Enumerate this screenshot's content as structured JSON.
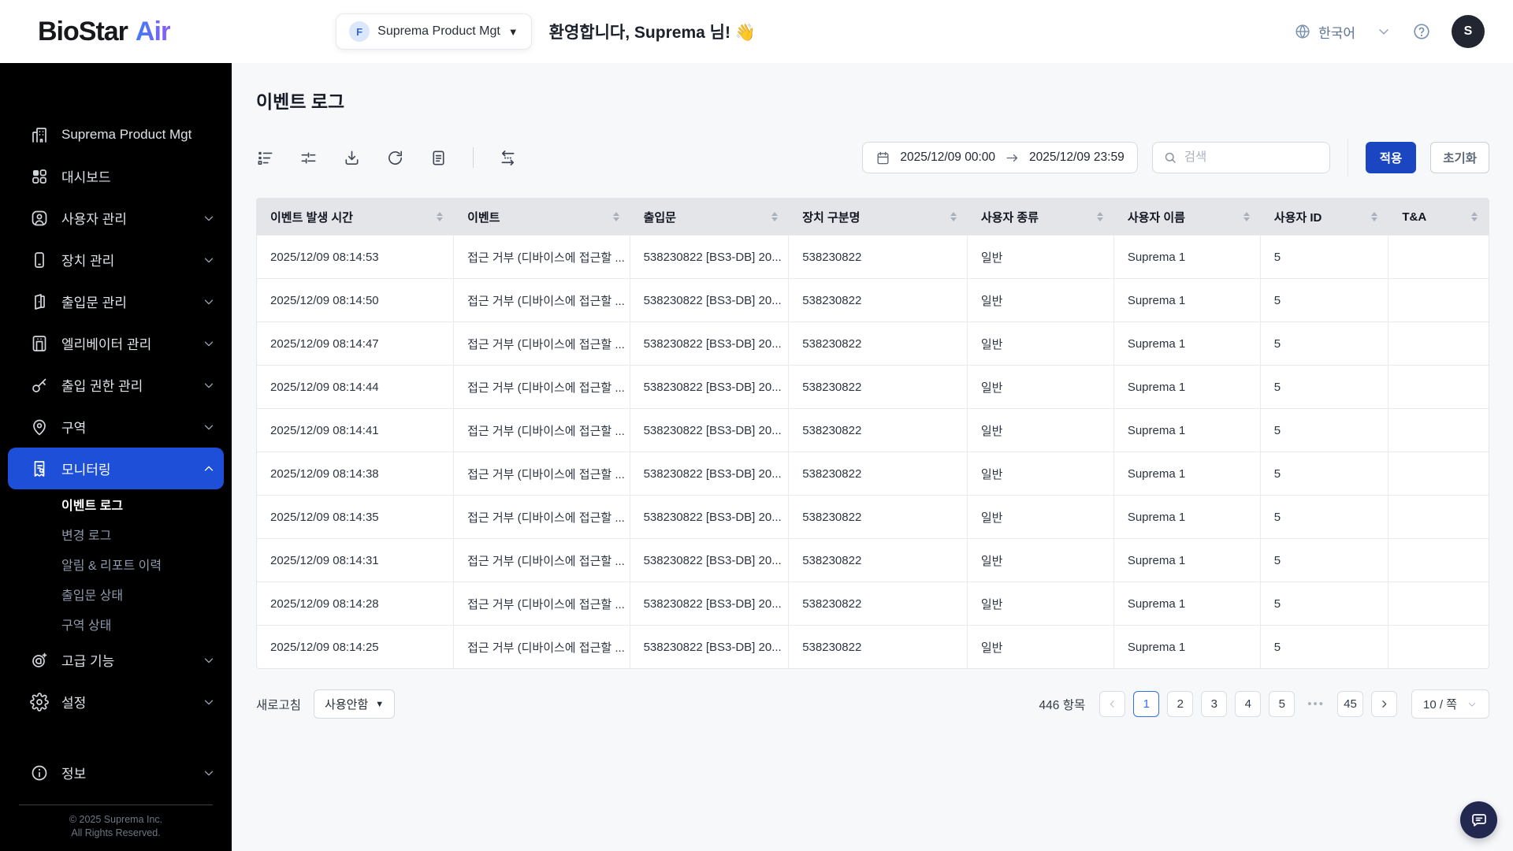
{
  "header": {
    "logo": {
      "part1": "BioStar",
      "part2": "Air"
    },
    "org_selector": {
      "badge": "F",
      "label": "Suprema Product Mgt"
    },
    "welcome": "환영합니다, Suprema 님! 👋",
    "language": "한국어",
    "avatar_initial": "S"
  },
  "sidebar": {
    "items": [
      {
        "label": "Suprema Product Mgt",
        "icon": "building",
        "expandable": false
      },
      {
        "label": "대시보드",
        "icon": "dashboard",
        "expandable": false
      },
      {
        "label": "사용자 관리",
        "icon": "users",
        "expandable": true
      },
      {
        "label": "장치 관리",
        "icon": "device",
        "expandable": true
      },
      {
        "label": "출입문 관리",
        "icon": "door",
        "expandable": true
      },
      {
        "label": "엘리베이터 관리",
        "icon": "elevator",
        "expandable": true
      },
      {
        "label": "출입 권한 관리",
        "icon": "key",
        "expandable": true
      },
      {
        "label": "구역",
        "icon": "zone",
        "expandable": true
      },
      {
        "label": "모니터링",
        "icon": "monitoring",
        "expandable": true,
        "active": true,
        "expanded": true,
        "children": [
          "이벤트 로그",
          "변경 로그",
          "알림 & 리포트 이력",
          "출입문 상태",
          "구역 상태"
        ],
        "active_child": "이벤트 로그"
      },
      {
        "label": "고급 기능",
        "icon": "advanced",
        "expandable": true
      },
      {
        "label": "설정",
        "icon": "settings",
        "expandable": true
      }
    ],
    "info_item": {
      "label": "정보",
      "icon": "info",
      "expandable": true
    },
    "copyright_line1": "© 2025 Suprema Inc.",
    "copyright_line2": "All Rights Reserved."
  },
  "page": {
    "title": "이벤트 로그"
  },
  "toolbar": {
    "date_from": "2025/12/09 00:00",
    "date_to": "2025/12/09 23:59",
    "search_placeholder": "검색",
    "apply_label": "적용",
    "reset_label": "초기화"
  },
  "table": {
    "columns": [
      "이벤트 발생 시간",
      "이벤트",
      "출입문",
      "장치 구분명",
      "사용자 종류",
      "사용자 이름",
      "사용자 ID",
      "T&A"
    ],
    "rows": [
      {
        "time": "2025/12/09 08:14:53",
        "event": "접근 거부 (디바이스에 접근할 ...",
        "door": "538230822 [BS3-DB] 20...",
        "device": "538230822",
        "user_type": "일반",
        "user_name": "Suprema 1",
        "user_id": "5",
        "tna": ""
      },
      {
        "time": "2025/12/09 08:14:50",
        "event": "접근 거부 (디바이스에 접근할 ...",
        "door": "538230822 [BS3-DB] 20...",
        "device": "538230822",
        "user_type": "일반",
        "user_name": "Suprema 1",
        "user_id": "5",
        "tna": ""
      },
      {
        "time": "2025/12/09 08:14:47",
        "event": "접근 거부 (디바이스에 접근할 ...",
        "door": "538230822 [BS3-DB] 20...",
        "device": "538230822",
        "user_type": "일반",
        "user_name": "Suprema 1",
        "user_id": "5",
        "tna": ""
      },
      {
        "time": "2025/12/09 08:14:44",
        "event": "접근 거부 (디바이스에 접근할 ...",
        "door": "538230822 [BS3-DB] 20...",
        "device": "538230822",
        "user_type": "일반",
        "user_name": "Suprema 1",
        "user_id": "5",
        "tna": ""
      },
      {
        "time": "2025/12/09 08:14:41",
        "event": "접근 거부 (디바이스에 접근할 ...",
        "door": "538230822 [BS3-DB] 20...",
        "device": "538230822",
        "user_type": "일반",
        "user_name": "Suprema 1",
        "user_id": "5",
        "tna": ""
      },
      {
        "time": "2025/12/09 08:14:38",
        "event": "접근 거부 (디바이스에 접근할 ...",
        "door": "538230822 [BS3-DB] 20...",
        "device": "538230822",
        "user_type": "일반",
        "user_name": "Suprema 1",
        "user_id": "5",
        "tna": ""
      },
      {
        "time": "2025/12/09 08:14:35",
        "event": "접근 거부 (디바이스에 접근할 ...",
        "door": "538230822 [BS3-DB] 20...",
        "device": "538230822",
        "user_type": "일반",
        "user_name": "Suprema 1",
        "user_id": "5",
        "tna": ""
      },
      {
        "time": "2025/12/09 08:14:31",
        "event": "접근 거부 (디바이스에 접근할 ...",
        "door": "538230822 [BS3-DB] 20...",
        "device": "538230822",
        "user_type": "일반",
        "user_name": "Suprema 1",
        "user_id": "5",
        "tna": ""
      },
      {
        "time": "2025/12/09 08:14:28",
        "event": "접근 거부 (디바이스에 접근할 ...",
        "door": "538230822 [BS3-DB] 20...",
        "device": "538230822",
        "user_type": "일반",
        "user_name": "Suprema 1",
        "user_id": "5",
        "tna": ""
      },
      {
        "time": "2025/12/09 08:14:25",
        "event": "접근 거부 (디바이스에 접근할 ...",
        "door": "538230822 [BS3-DB] 20...",
        "device": "538230822",
        "user_type": "일반",
        "user_name": "Suprema 1",
        "user_id": "5",
        "tna": ""
      }
    ]
  },
  "footer": {
    "refresh_label": "새로고침",
    "refresh_option": "사용안함",
    "total": "446 항목",
    "pages": [
      "1",
      "2",
      "3",
      "4",
      "5",
      "•••",
      "45"
    ],
    "active_page": "1",
    "page_size": "10 / 쪽"
  },
  "colors": {
    "sidebar_bg": "#000000",
    "active_menu": "#1d4fd8",
    "apply_button": "#1b46c2",
    "pagination_accent": "#2f6fed",
    "logo_gradient_start": "#3d7bfd",
    "logo_gradient_end": "#8b5cf6"
  }
}
